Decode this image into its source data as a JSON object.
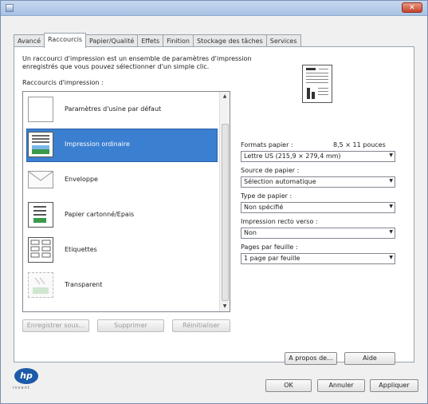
{
  "tabs": [
    "Avancé",
    "Raccourcis",
    "Papier/Qualité",
    "Effets",
    "Finition",
    "Stockage des tâches",
    "Services"
  ],
  "active_tab": 1,
  "description_line1": "Un raccourci d'impression est un ensemble de paramètres d'impression",
  "description_line2": "enregistrés que vous pouvez sélectionner d'un simple clic.",
  "shortcuts_label": "Raccourcis d'impression :",
  "shortcuts": [
    {
      "label": "Paramètres d'usine par défaut",
      "icon": "blank-page-icon"
    },
    {
      "label": "Impression ordinaire",
      "icon": "document-image-icon"
    },
    {
      "label": "Enveloppe",
      "icon": "envelope-icon"
    },
    {
      "label": "Papier cartonné/Epais",
      "icon": "cardstock-icon"
    },
    {
      "label": "Etiquettes",
      "icon": "labels-icon"
    },
    {
      "label": "Transparent",
      "icon": "transparency-icon"
    }
  ],
  "selected_shortcut": 1,
  "list_buttons": {
    "save": "Enregistrer sous...",
    "delete": "Supprimer",
    "reset": "Réinitialiser"
  },
  "paper_formats": {
    "label": "Formats papier :",
    "size_text": "8,5 × 11 pouces",
    "value": "Lettre US (215,9 × 279,4 mm)"
  },
  "paper_source": {
    "label": "Source de papier :",
    "value": "Sélection automatique"
  },
  "paper_type": {
    "label": "Type de papier :",
    "value": "Non spécifié"
  },
  "duplex": {
    "label": "Impression recto verso :",
    "value": "Non"
  },
  "pages_per_sheet": {
    "label": "Pages par feuille :",
    "value": "1 page par feuille"
  },
  "footer": {
    "about": "A propos de...",
    "help": "Aide",
    "ok": "OK",
    "cancel": "Annuler",
    "apply": "Appliquer"
  },
  "logo_text": "hp",
  "logo_sub": "invent",
  "colors": {
    "selection": "#3b7fd0",
    "titlebar": "#b6cbe9",
    "close": "#c4432b"
  }
}
